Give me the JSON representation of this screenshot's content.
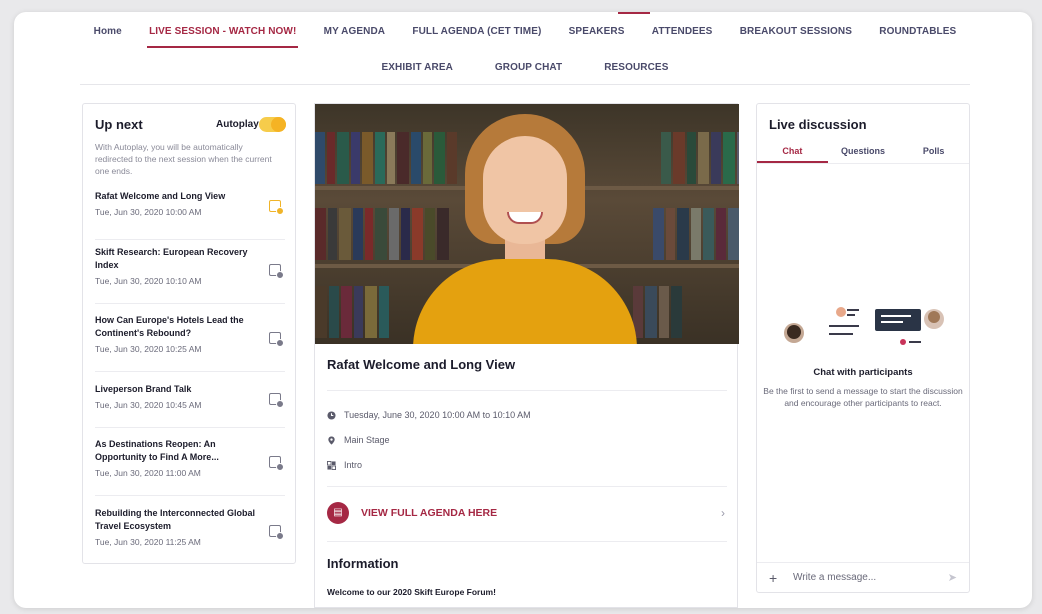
{
  "nav": {
    "row1": [
      "Home",
      "LIVE SESSION - WATCH NOW!",
      "MY AGENDA",
      "FULL AGENDA (CET TIME)",
      "SPEAKERS",
      "ATTENDEES",
      "BREAKOUT SESSIONS",
      "ROUNDTABLES"
    ],
    "row2": [
      "EXHIBIT AREA",
      "GROUP CHAT",
      "RESOURCES"
    ],
    "active": "LIVE SESSION - WATCH NOW!"
  },
  "up_next": {
    "title": "Up next",
    "autoplay_label": "Autoplay",
    "autoplay_on": true,
    "description": "With Autoplay, you will be automatically redirected to the next session when the current one ends.",
    "sessions": [
      {
        "title": "Rafat Welcome and Long View",
        "time": "Tue, Jun 30, 2020 10:00 AM"
      },
      {
        "title": "Skift Research: European Recovery Index",
        "time": "Tue, Jun 30, 2020 10:10 AM"
      },
      {
        "title": "How Can Europe's Hotels Lead the Continent's Rebound?",
        "time": "Tue, Jun 30, 2020 10:25 AM"
      },
      {
        "title": "Liveperson Brand Talk",
        "time": "Tue, Jun 30, 2020 10:45 AM"
      },
      {
        "title": "As Destinations Reopen: An Opportunity to Find A More...",
        "time": "Tue, Jun 30, 2020 11:00 AM"
      },
      {
        "title": "Rebuilding the Interconnected Global Travel Ecosystem",
        "time": "Tue, Jun 30, 2020 11:25 AM"
      }
    ]
  },
  "session": {
    "title": "Rafat Welcome and Long View",
    "datetime": "Tuesday, June 30, 2020 10:00 AM to 10:10 AM",
    "location": "Main Stage",
    "track": "Intro",
    "view_agenda": "VIEW FULL AGENDA HERE",
    "info_heading": "Information",
    "welcome": "Welcome to our 2020 Skift Europe Forum!"
  },
  "live": {
    "title": "Live discussion",
    "tabs": [
      "Chat",
      "Questions",
      "Polls"
    ],
    "chat_heading": "Chat with participants",
    "chat_sub": "Be the first to send a message to start the discussion and encourage other participants to react.",
    "placeholder": "Write a message..."
  },
  "colors": {
    "accent": "#a52844",
    "autoplay": "#f5b324"
  }
}
